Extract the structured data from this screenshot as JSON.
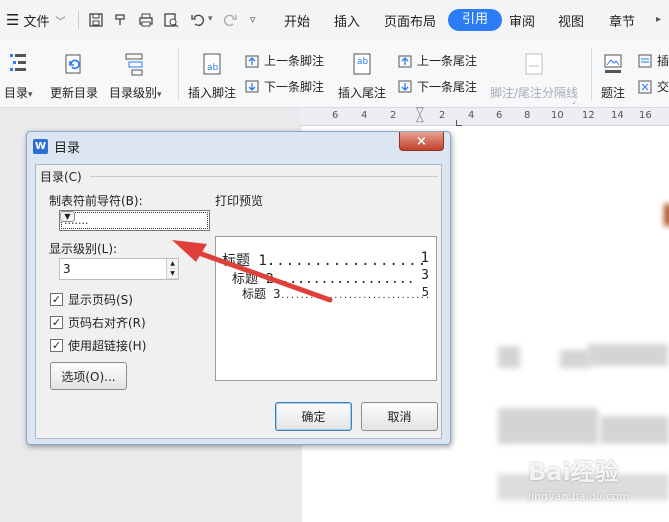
{
  "tabbar": {
    "menu_label": "文件",
    "tabs": [
      "开始",
      "插入",
      "页面布局",
      "引用",
      "审阅",
      "视图",
      "章节"
    ],
    "active_tab": "引用"
  },
  "ribbon": {
    "toc": "目录",
    "update_toc": "更新目录",
    "toc_level": "目录级别",
    "insert_footnote": "插入脚注",
    "prev_footnote": "上一条脚注",
    "next_footnote": "下一条脚注",
    "insert_endnote": "插入尾注",
    "prev_endnote": "上一条尾注",
    "next_endnote": "下一条尾注",
    "separator_line": "脚注/尾注分隔线",
    "caption": "题注",
    "insert_short": "插",
    "cross_short": "交"
  },
  "ruler": {
    "ticks": [
      "6",
      "4",
      "2",
      "2",
      "4",
      "6",
      "8",
      "10",
      "12",
      "14",
      "16"
    ]
  },
  "dialog": {
    "title": "目录",
    "close": "×",
    "group_label": "目录(C)",
    "tab_leader_label": "制表符前导符(B):",
    "tab_leader_value": ".......",
    "show_levels_label": "显示级别(L):",
    "show_levels_value": "3",
    "checkboxes": [
      {
        "label": "显示页码(S)",
        "checked": true
      },
      {
        "label": "页码右对齐(R)",
        "checked": true
      },
      {
        "label": "使用超链接(H)",
        "checked": true
      }
    ],
    "options_button": "选项(O)...",
    "preview_label": "打印预览",
    "preview_lines": [
      {
        "text": "标题 1",
        "page": "1"
      },
      {
        "text": "标题 2",
        "page": "3"
      },
      {
        "text": "标题 3",
        "page": "5"
      }
    ],
    "ok": "确定",
    "cancel": "取消"
  },
  "watermark": {
    "brand": "Bai经验",
    "url": "jingyan.baidu.com"
  },
  "colors": {
    "accent": "#2b7cf6",
    "annotation_arrow": "#e0403a",
    "dialog_frame": "#dbe6f2",
    "close_button": "#c2412b"
  }
}
